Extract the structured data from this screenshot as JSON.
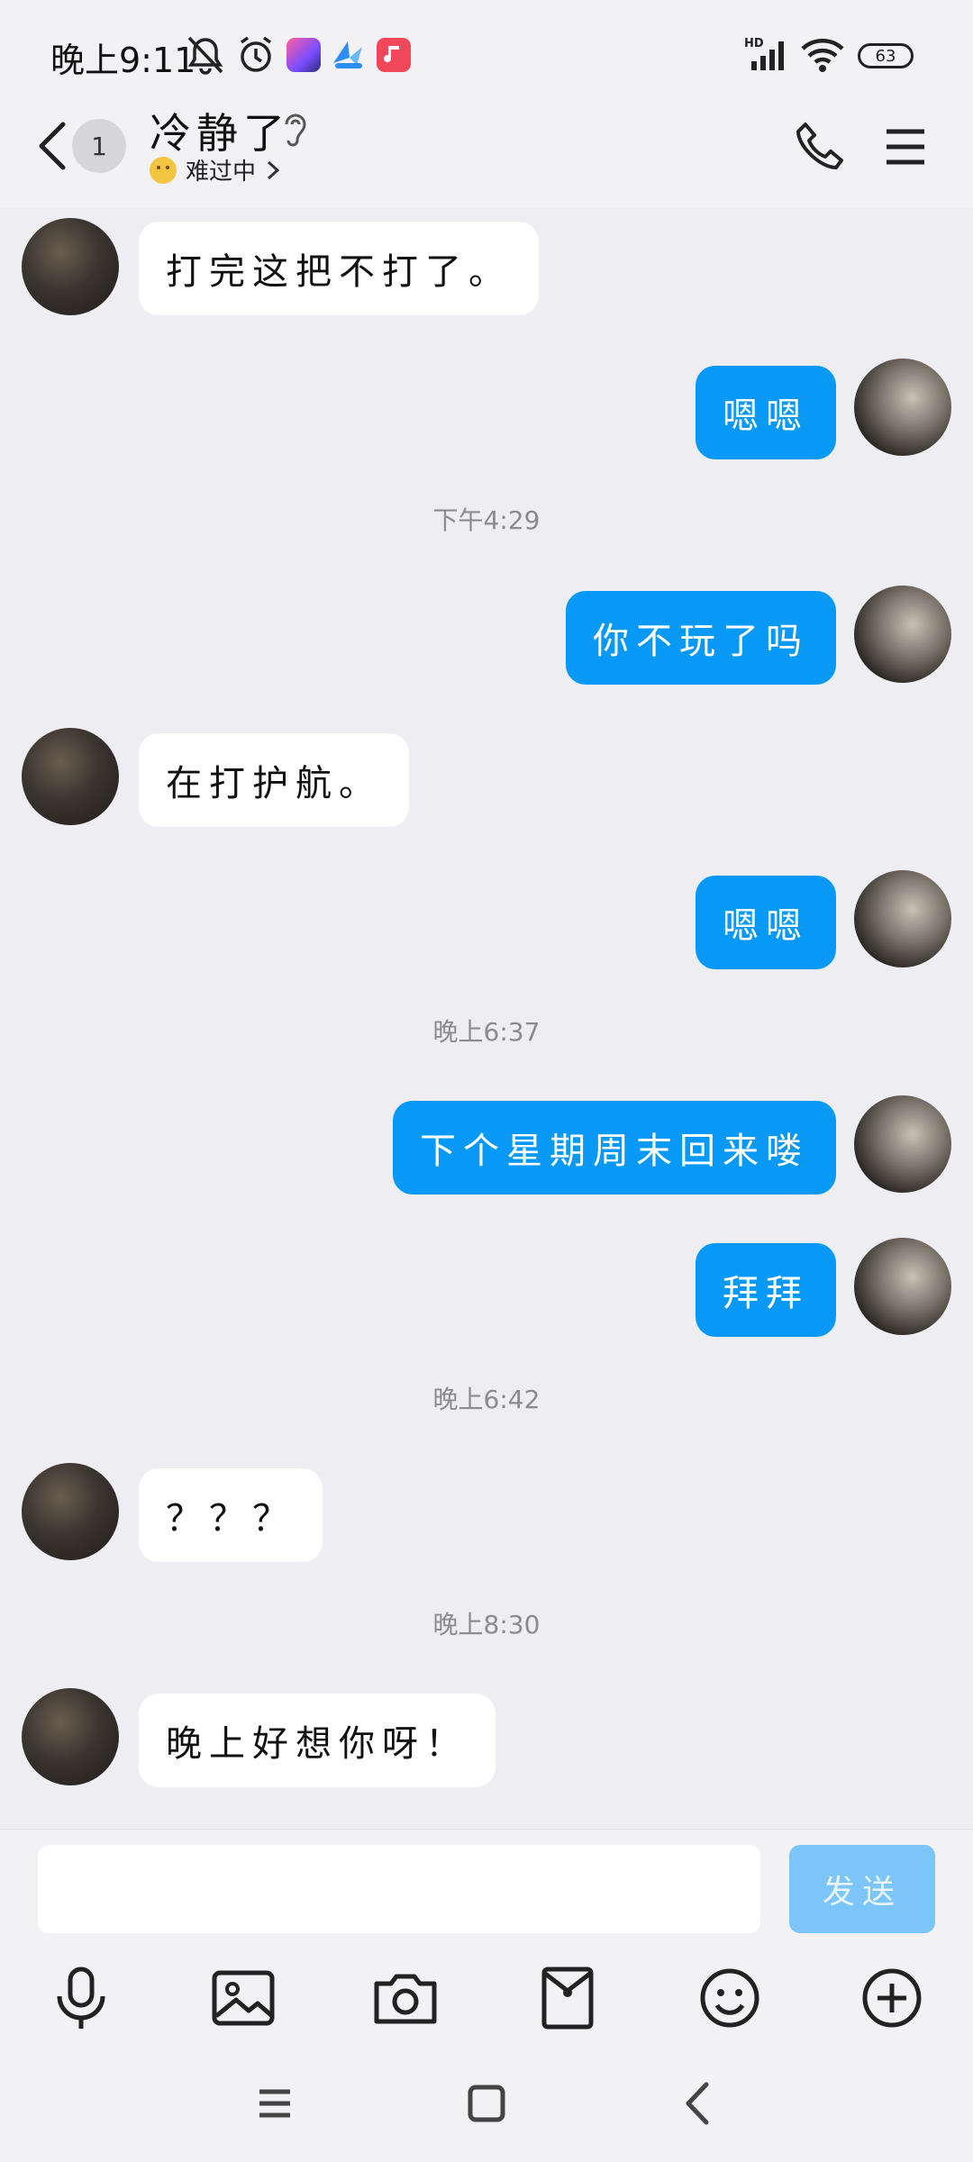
{
  "status_bar": {
    "time": "晚上9:11",
    "battery": "63"
  },
  "header": {
    "unread_count": "1",
    "contact_name": "冷静了",
    "contact_status": "难过中"
  },
  "messages": [
    {
      "side": "in",
      "text": "打完这把不打了。"
    },
    {
      "side": "out",
      "text": "嗯嗯"
    },
    {
      "type": "time",
      "text": "下午4:29"
    },
    {
      "side": "out",
      "text": "你不玩了吗"
    },
    {
      "side": "in",
      "text": "在打护航。"
    },
    {
      "side": "out",
      "text": "嗯嗯"
    },
    {
      "type": "time",
      "text": "晚上6:37"
    },
    {
      "side": "out",
      "text": "下个星期周末回来喽"
    },
    {
      "side": "out",
      "text": "拜拜"
    },
    {
      "type": "time",
      "text": "晚上6:42"
    },
    {
      "side": "in",
      "text": "？？？"
    },
    {
      "type": "time",
      "text": "晚上8:30"
    },
    {
      "side": "in",
      "text": "晚上好想你呀！"
    }
  ],
  "composer": {
    "input_value": "",
    "send_label": "发送"
  },
  "toolbar_icons": [
    "microphone-icon",
    "image-icon",
    "camera-icon",
    "red-packet-icon",
    "emoji-icon",
    "plus-icon"
  ],
  "colors": {
    "outgoing_bubble": "#0899f7",
    "incoming_bubble": "#ffffff",
    "background": "#ededf2",
    "send_button": "#7cc5f9"
  }
}
